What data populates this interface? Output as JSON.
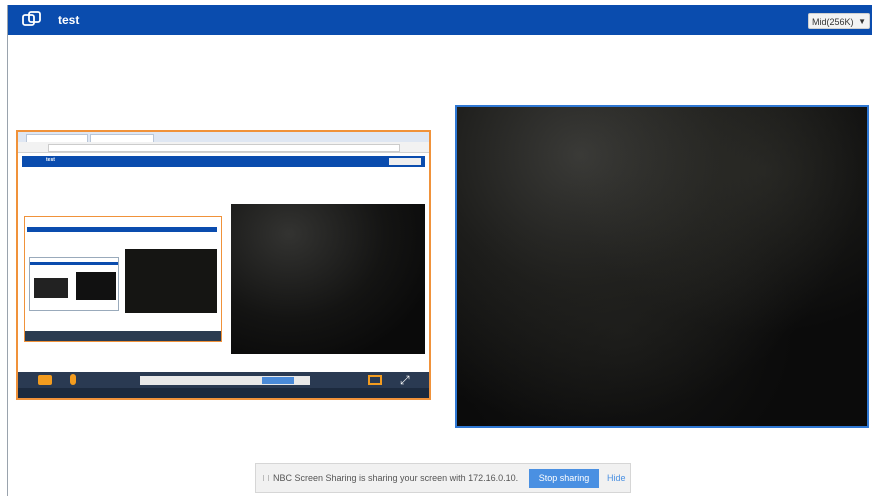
{
  "header": {
    "title": "test",
    "quality_select": "Mid(256K)",
    "logo_icon": "chat-bubbles-icon",
    "background": "#0a4cae"
  },
  "local_preview": {
    "border_color": "#f0923a",
    "toolbar_icons": [
      "camera-icon",
      "microphone-icon",
      "screen-share-icon",
      "fullscreen-icon"
    ]
  },
  "remote_video": {
    "border_color": "#2f78d4"
  },
  "share_notification": {
    "message": "NBC Screen Sharing is sharing your screen with 172.16.0.10.",
    "stop_label": "Stop sharing",
    "hide_label": "Hide"
  }
}
